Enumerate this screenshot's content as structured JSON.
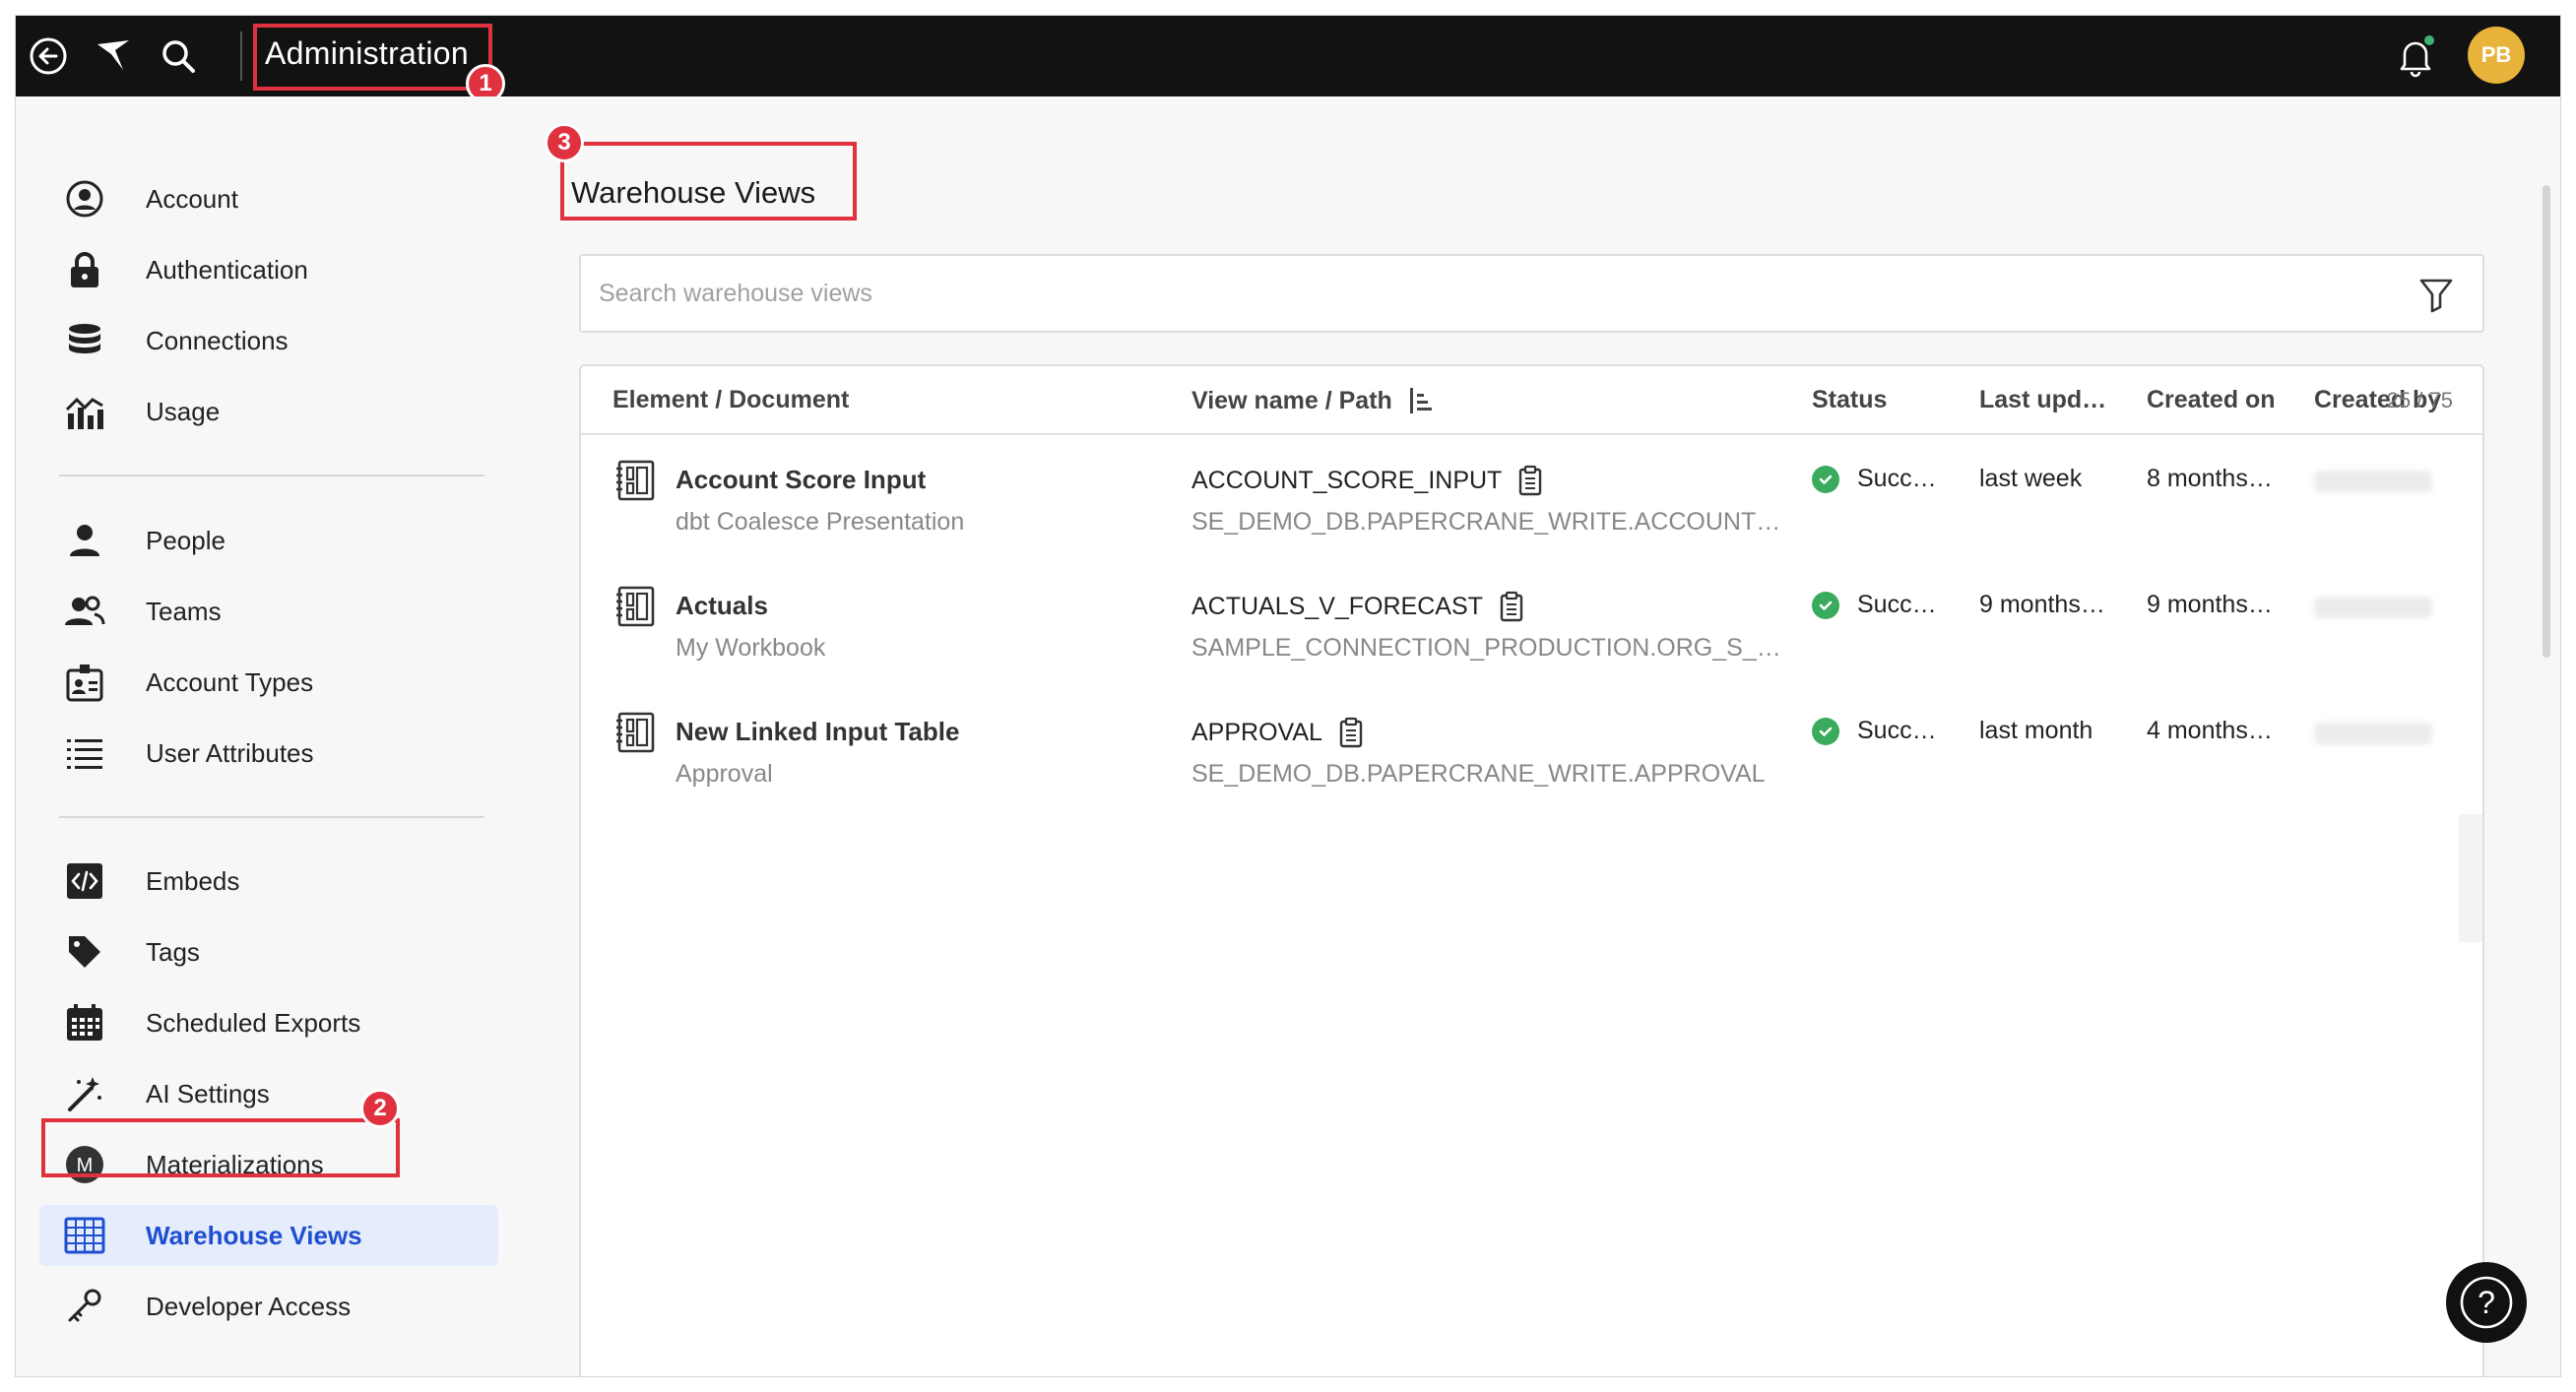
{
  "topbar": {
    "title": "Administration",
    "avatar_initials": "PB",
    "notification_dot_color": "#3cb371",
    "icons": [
      "back-arrow-icon",
      "logo-icon",
      "search-icon",
      "bell-icon"
    ]
  },
  "annotations": [
    "1",
    "2",
    "3"
  ],
  "sidebar": {
    "groups": [
      [
        {
          "label": "Account",
          "icon": "user-circle-icon"
        },
        {
          "label": "Authentication",
          "icon": "lock-icon"
        },
        {
          "label": "Connections",
          "icon": "database-icon"
        },
        {
          "label": "Usage",
          "icon": "usage-chart-icon"
        }
      ],
      [
        {
          "label": "People",
          "icon": "person-icon"
        },
        {
          "label": "Teams",
          "icon": "team-icon"
        },
        {
          "label": "Account Types",
          "icon": "id-badge-icon"
        },
        {
          "label": "User Attributes",
          "icon": "list-icon"
        }
      ],
      [
        {
          "label": "Embeds",
          "icon": "code-icon"
        },
        {
          "label": "Tags",
          "icon": "tag-icon"
        },
        {
          "label": "Scheduled Exports",
          "icon": "calendar-icon"
        },
        {
          "label": "AI Settings",
          "icon": "magic-wand-icon"
        },
        {
          "label": "Materializations",
          "icon": "m-circle-icon"
        },
        {
          "label": "Warehouse Views",
          "icon": "table-grid-icon",
          "active": true
        },
        {
          "label": "Developer Access",
          "icon": "key-icon"
        }
      ]
    ]
  },
  "main": {
    "title": "Warehouse Views",
    "search_placeholder": "Search warehouse views",
    "count": "25 / 75",
    "columns": {
      "element": "Element / Document",
      "view": "View name / Path",
      "status": "Status",
      "updated": "Last upd…",
      "created": "Created on",
      "created_by": "Created by"
    },
    "rows": [
      {
        "name": "Account Score Input",
        "document": "dbt Coalesce Presentation",
        "view_name": "ACCOUNT_SCORE_INPUT",
        "path": "SE_DEMO_DB.PAPERCRANE_WRITE.ACCOUNT_S…",
        "status": "Succ…",
        "updated": "last week",
        "created": "8 months…"
      },
      {
        "name": "Actuals",
        "document": "My Workbook",
        "view_name": "ACTUALS_V_FORECAST",
        "path": "SAMPLE_CONNECTION_PRODUCTION.ORG_S_4E…",
        "status": "Succ…",
        "updated": "9 months…",
        "created": "9 months…"
      },
      {
        "name": "New Linked Input Table",
        "document": "Approval",
        "view_name": "APPROVAL",
        "path": "SE_DEMO_DB.PAPERCRANE_WRITE.APPROVAL",
        "status": "Succ…",
        "updated": "last month",
        "created": "4 months…"
      }
    ]
  },
  "help_label": "?"
}
